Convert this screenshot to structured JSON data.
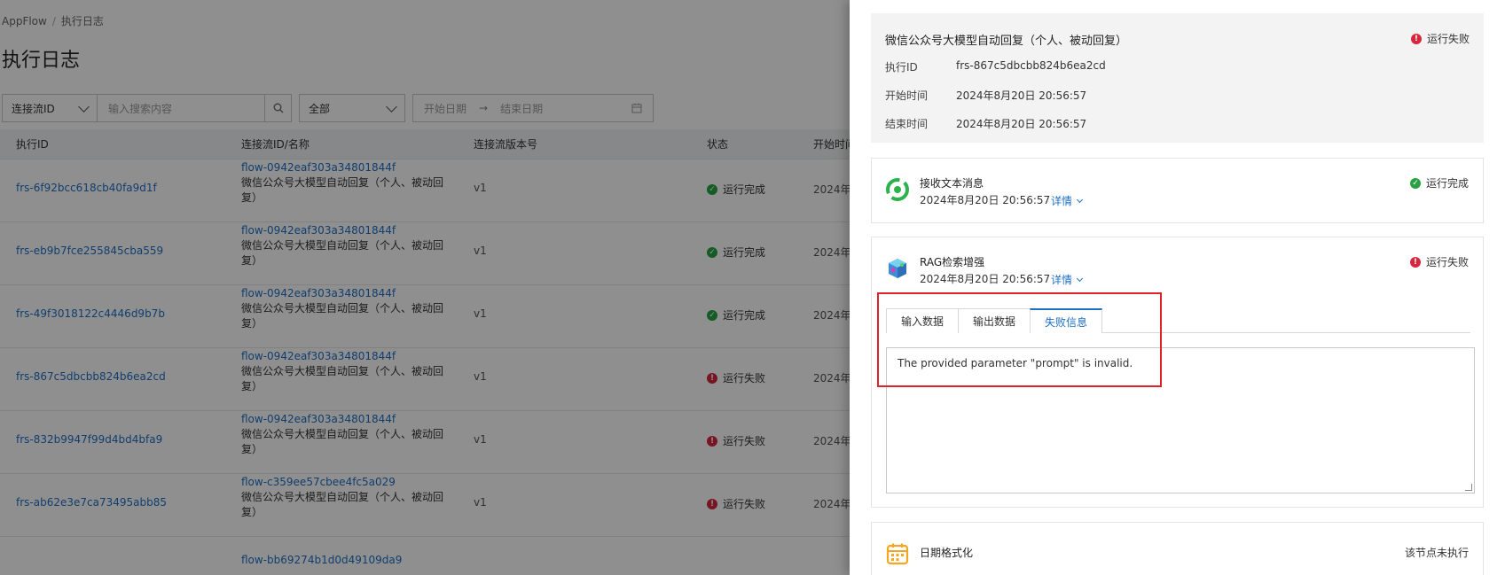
{
  "breadcrumb": {
    "root": "AppFlow",
    "separator": "/",
    "current": "执行日志"
  },
  "page_title": "执行日志",
  "filters": {
    "field_select": "连接流ID",
    "search_placeholder": "输入搜索内容",
    "status_select": "全部",
    "date_start_placeholder": "开始日期",
    "date_arrow": "→",
    "date_end_placeholder": "结束日期"
  },
  "table": {
    "headers": {
      "id": "执行ID",
      "name": "连接流ID/名称",
      "version": "连接流版本号",
      "status": "状态",
      "start": "开始时间"
    },
    "start_visible": "2024年",
    "rows": [
      {
        "id": "frs-6f92bcc618cb40fa9d1f",
        "flow_id": "flow-0942eaf303a34801844f",
        "flow_name": "微信公众号大模型自动回复（个人、被动回复）",
        "version": "v1",
        "status": "运行完成",
        "status_type": "ok"
      },
      {
        "id": "frs-eb9b7fce255845cba559",
        "flow_id": "flow-0942eaf303a34801844f",
        "flow_name": "微信公众号大模型自动回复（个人、被动回复）",
        "version": "v1",
        "status": "运行完成",
        "status_type": "ok"
      },
      {
        "id": "frs-49f3018122c4446d9b7b",
        "flow_id": "flow-0942eaf303a34801844f",
        "flow_name": "微信公众号大模型自动回复（个人、被动回复）",
        "version": "v1",
        "status": "运行完成",
        "status_type": "ok"
      },
      {
        "id": "frs-867c5dbcbb824b6ea2cd",
        "flow_id": "flow-0942eaf303a34801844f",
        "flow_name": "微信公众号大模型自动回复（个人、被动回复）",
        "version": "v1",
        "status": "运行失败",
        "status_type": "err"
      },
      {
        "id": "frs-832b9947f99d4bd4bfa9",
        "flow_id": "flow-0942eaf303a34801844f",
        "flow_name": "微信公众号大模型自动回复（个人、被动回复）",
        "version": "v1",
        "status": "运行失败",
        "status_type": "err"
      },
      {
        "id": "frs-ab62e3e7ca73495abb85",
        "flow_id": "flow-c359ee57cbee4fc5a029",
        "flow_name": "微信公众号大模型自动回复（个人、被动回复）",
        "version": "v1",
        "status": "运行失败",
        "status_type": "err"
      }
    ],
    "partial_row_flow_id": "flow-bb69274b1d0d49109da9"
  },
  "drawer": {
    "summary": {
      "title": "微信公众号大模型自动回复（个人、被动回复）",
      "status": "运行失败",
      "exec_id_label": "执行ID",
      "exec_id": "frs-867c5dbcbb824b6ea2cd",
      "start_label": "开始时间",
      "start_time": "2024年8月20日 20:56:57",
      "end_label": "结束时间",
      "end_time": "2024年8月20日 20:56:57"
    },
    "nodes": [
      {
        "name": "接收文本消息",
        "time": "2024年8月20日 20:56:57",
        "detail": "详情",
        "status": "运行完成"
      },
      {
        "name": "RAG检索增强",
        "time": "2024年8月20日 20:56:57",
        "detail": "详情",
        "status": "运行失败",
        "tabs": [
          "输入数据",
          "输出数据",
          "失败信息"
        ],
        "error_message": "The provided parameter \"prompt\" is invalid."
      },
      {
        "name": "日期格式化",
        "status": "该节点未执行"
      }
    ]
  },
  "colors": {
    "link": "#1f6fc5",
    "success": "#27a243",
    "error": "#d7263d",
    "highlight": "#e0222b"
  }
}
